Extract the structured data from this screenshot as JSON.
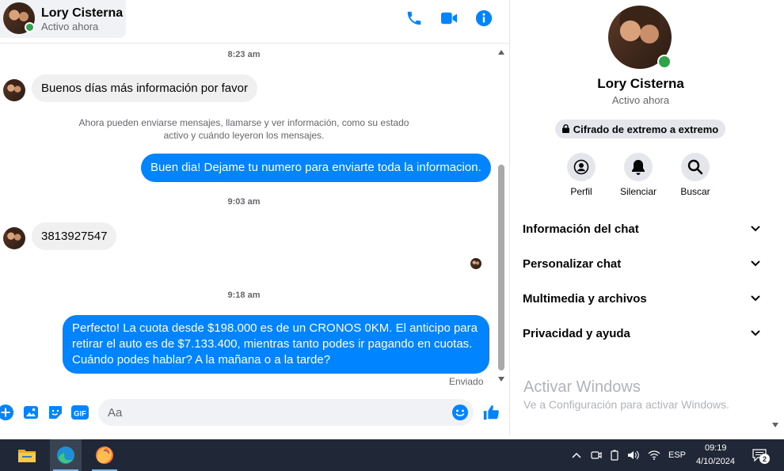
{
  "header": {
    "contact_name": "Lory Cisterna",
    "contact_status": "Activo ahora",
    "icons": [
      "phone-icon",
      "video-icon",
      "info-icon"
    ],
    "accent_color": "#0084ff"
  },
  "messages": {
    "timestamps": [
      "8:23 am",
      "9:03 am",
      "9:18 am"
    ],
    "incoming": [
      "Buenos días más información por favor",
      "3813927547"
    ],
    "system_note": "Ahora pueden enviarse mensajes, llamarse y ver información, como su estado activo y cuándo leyeron los mensajes.",
    "outgoing": [
      "Buen dia! Dejame tu numero para enviarte toda la informacion.",
      "Perfecto! La cuota desde $198.000 es de un CRONOS 0KM. El anticipo para retirar el auto es de $7.133.400, mientras tanto podes ir pagando en cuotas. Cuándo podes hablar? A la mañana o a la tarde?"
    ],
    "sent_label": "Enviado"
  },
  "composer": {
    "placeholder": "Aa",
    "icons": [
      "plus-icon",
      "image-icon",
      "sticker-icon",
      "gif-icon",
      "emoji-icon",
      "like-icon"
    ],
    "gif_label": "GIF"
  },
  "panel": {
    "name": "Lory Cisterna",
    "status": "Activo ahora",
    "encryption_label": "Cifrado de extremo a extremo",
    "actions": [
      {
        "label": "Perfil",
        "icon": "profile-icon"
      },
      {
        "label": "Silenciar",
        "icon": "bell-icon"
      },
      {
        "label": "Buscar",
        "icon": "search-icon"
      }
    ],
    "sections": [
      "Información del chat",
      "Personalizar chat",
      "Multimedia y archivos",
      "Privacidad y ayuda"
    ],
    "watermark_title": "Activar Windows",
    "watermark_subtitle": "Ve a Configuración para activar Windows."
  },
  "taskbar": {
    "apps": [
      "file-explorer-icon",
      "edge-icon",
      "firefox-icon"
    ],
    "language": "ESP",
    "time": "09:19",
    "date": "4/10/2024",
    "notification_count": "2"
  }
}
